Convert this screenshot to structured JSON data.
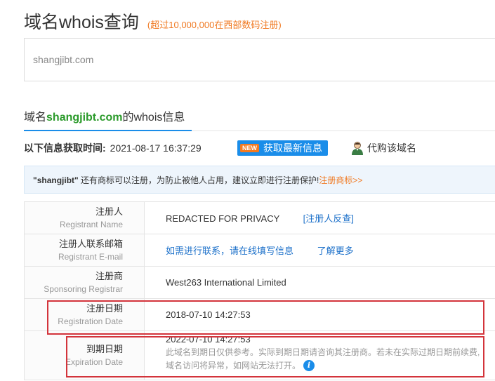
{
  "header": {
    "title": "域名whois查询",
    "subtitle": "(超过10,000,000在西部数码注册)"
  },
  "search": {
    "value": "shangjibt.com"
  },
  "section": {
    "prefix": "域名",
    "domain": "shangjibt.com",
    "suffix": "的whois信息"
  },
  "info_bar": {
    "fetch_time_label": "以下信息获取时间:",
    "fetch_time": "2021-08-17 16:37:29",
    "new_badge": "NEW",
    "refresh_label": "获取最新信息",
    "buy_label": "代购该域名"
  },
  "notice": {
    "keyword": "\"shangjibt\"",
    "text": " 还有商标可以注册，为防止被他人占用，建议立即进行注册保护!",
    "link": "注册商标>>"
  },
  "rows": [
    {
      "cn": "注册人",
      "en": "Registrant Name",
      "value": "REDACTED FOR PRIVACY",
      "link": "[注册人反查]"
    },
    {
      "cn": "注册人联系邮箱",
      "en": "Registrant E-mail",
      "link1": "如需进行联系，请在线填写信息",
      "link2": "了解更多"
    },
    {
      "cn": "注册商",
      "en": "Sponsoring Registrar",
      "value": "West263 International Limited"
    },
    {
      "cn": "注册日期",
      "en": "Registration Date",
      "value": "2018-07-10 14:27:53"
    },
    {
      "cn": "到期日期",
      "en": "Expiration Date",
      "value": "2022-07-10 14:27:53",
      "note1": "此域名到期日仅供参考。实际到期日期请咨询其注册商。若未在实际过期日期前续费,",
      "note2": "域名访问将异常，如网站无法打开。",
      "info_icon": "i"
    }
  ],
  "colors": {
    "accent": "#1a8de9",
    "orange": "#f07a23",
    "green": "#2a9a2a",
    "highlight": "#d3343b"
  }
}
